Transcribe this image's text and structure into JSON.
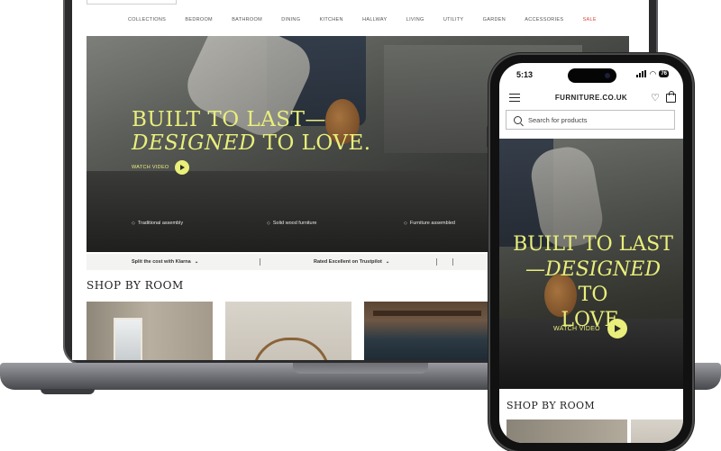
{
  "desktop": {
    "nav": [
      "COLLECTIONS",
      "BEDROOM",
      "BATHROOM",
      "DINING",
      "KITCHEN",
      "HALLWAY",
      "LIVING",
      "UTILITY",
      "GARDEN",
      "ACCESSORIES",
      "SALE"
    ],
    "hero": {
      "line1": "BUILT TO LAST—",
      "line2_italic": "DESIGNED",
      "line2_rest": " TO LOVE.",
      "watch_label": "WATCH VIDEO",
      "usps": [
        "Traditional assembly",
        "Solid wood furniture",
        "Furniture assembled"
      ]
    },
    "info_bar": {
      "klarna": "Split the cost with Klarna",
      "trustpilot": "Rated Excellent on Trustpilot"
    },
    "section_title": "SHOP BY ROOM"
  },
  "mobile": {
    "status": {
      "time": "5:13",
      "battery": "76"
    },
    "logo": "FURNITURE.CO.UK",
    "search_placeholder": "Search for products",
    "hero": {
      "line1": "BUILT TO LAST",
      "line2_italic": "—DESIGNED",
      "line2_rest": " TO",
      "line3": "LOVE.",
      "watch_label": "WATCH VIDEO"
    },
    "section_title": "SHOP BY ROOM"
  },
  "colors": {
    "accent": "#e9ef7a",
    "sale": "#d6453d"
  },
  "icons": [
    "play-icon",
    "chevron-down-icon",
    "hamburger-icon",
    "heart-icon",
    "bag-icon",
    "search-icon",
    "wifi-icon",
    "signal-icon",
    "battery-icon"
  ]
}
